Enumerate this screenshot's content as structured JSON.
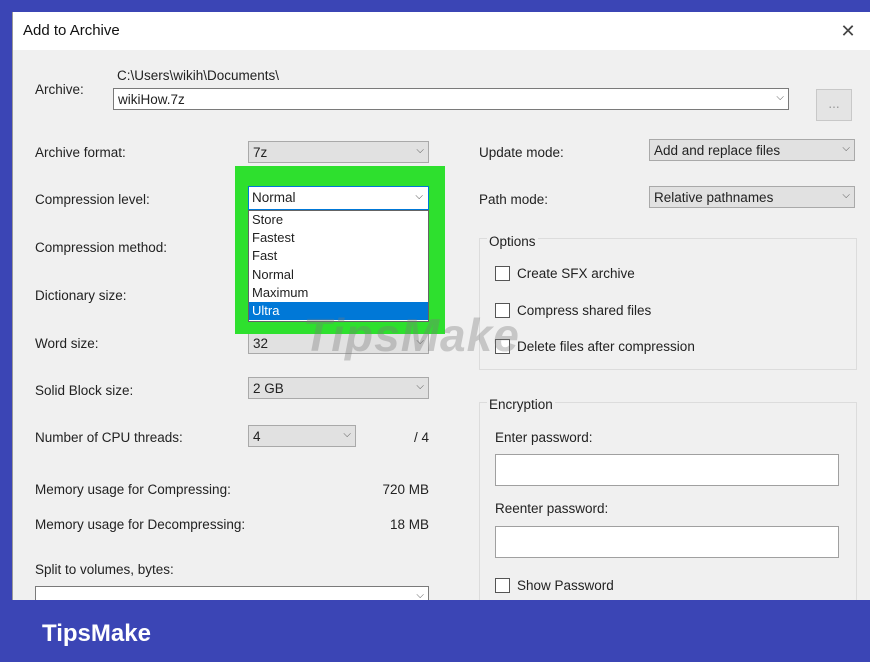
{
  "dialog": {
    "title": "Add to Archive",
    "close_glyph": "✕",
    "archive": {
      "label": "Archive:",
      "path": "C:\\Users\\wikih\\Documents\\",
      "value": "wikiHow.7z",
      "browse_label": "..."
    },
    "left": {
      "format": {
        "label": "Archive format:",
        "value": "7z"
      },
      "level": {
        "label": "Compression level:",
        "value": "Normal",
        "options": [
          "Store",
          "Fastest",
          "Fast",
          "Normal",
          "Maximum",
          "Ultra"
        ],
        "selected": "Ultra"
      },
      "method": {
        "label": "Compression method:"
      },
      "dictionary": {
        "label": "Dictionary size:"
      },
      "word": {
        "label": "Word size:",
        "value": "32"
      },
      "solid": {
        "label": "Solid Block size:",
        "value": "2 GB"
      },
      "threads": {
        "label": "Number of CPU threads:",
        "value": "4",
        "total": "/ 4"
      },
      "mem_compress": {
        "label": "Memory usage for Compressing:",
        "value": "720 MB"
      },
      "mem_decompress": {
        "label": "Memory usage for Decompressing:",
        "value": "18 MB"
      },
      "split": {
        "label": "Split to volumes, bytes:"
      }
    },
    "right": {
      "update": {
        "label": "Update mode:",
        "value": "Add and replace files"
      },
      "path": {
        "label": "Path mode:",
        "value": "Relative pathnames"
      },
      "options": {
        "label": "Options",
        "sfx": "Create SFX archive",
        "shared": "Compress shared files",
        "delete": "Delete files after compression"
      },
      "encryption": {
        "label": "Encryption",
        "enter": "Enter password:",
        "reenter": "Reenter password:",
        "show": "Show Password"
      }
    }
  },
  "watermark": "TipsMake",
  "footer": {
    "brand": "TipsMake"
  },
  "icons": {
    "dropdown": "chevron-down-icon",
    "close": "close-icon"
  },
  "colors": {
    "highlight": "#2ee02e",
    "selection": "#0078d7",
    "footer": "#3b45b5"
  }
}
